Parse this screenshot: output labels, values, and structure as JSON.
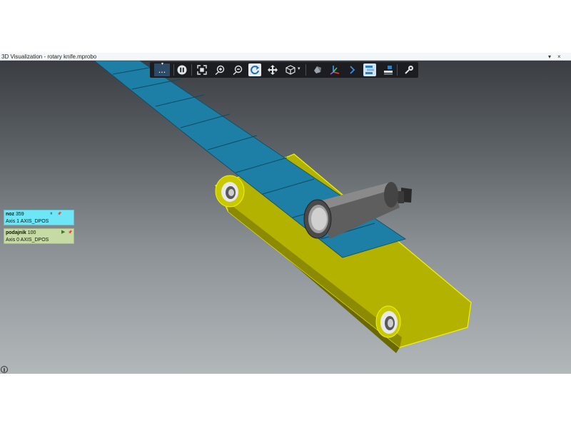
{
  "window": {
    "title": "3D Visualization - rotary knife.mprobo",
    "controls": {
      "dropdown": "▾",
      "close": "×"
    }
  },
  "toolbar": {
    "more_label": "...",
    "dropdown_caret": "▾",
    "buttons": [
      "pause-icon",
      "fit-view-icon",
      "zoom-in-icon",
      "zoom-out-icon",
      "rotate-icon",
      "pan-icon",
      "cube-view-icon",
      "scene-object-icon",
      "axes-icon",
      "chevron-right-icon",
      "panels-icon",
      "trace-icon",
      "settings-icon"
    ]
  },
  "axis_panels": [
    {
      "name": "noz",
      "value": "359",
      "axis": "Axis 1",
      "source": "AXIS_DPOS",
      "state_symbol": "⏸",
      "pin_symbol": "📌",
      "color": "#6ee6f5"
    },
    {
      "name": "podajnik",
      "value": "100",
      "axis": "Axis 0",
      "source": "AXIS_DPOS",
      "state_symbol": "▶",
      "pin_symbol": "📌",
      "color": "#c6dba4"
    }
  ],
  "info_button": {
    "label": "i"
  },
  "scene": {
    "colors": {
      "belt": "#b5b300",
      "belt_side": "#8d8b00",
      "product": "#1c7fa5",
      "product_lines": "#0d4a63",
      "knife": "#6f6f6f",
      "outline": "#f5f500"
    }
  }
}
